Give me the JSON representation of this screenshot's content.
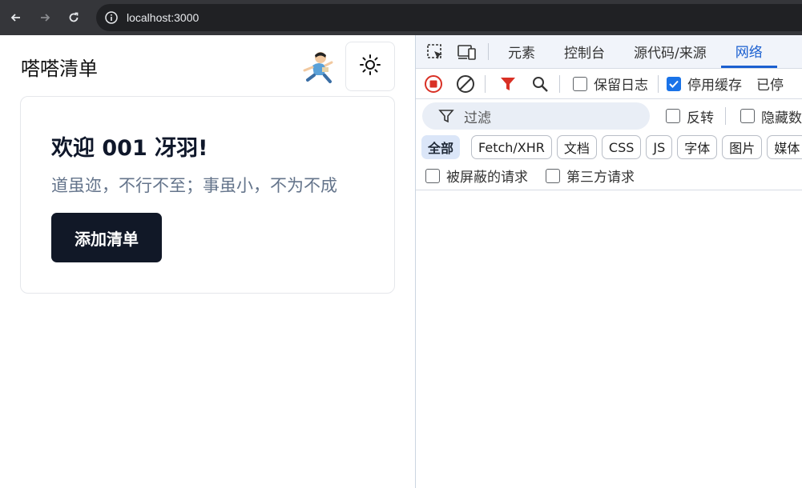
{
  "browser": {
    "url": "localhost:3000",
    "icons": [
      "back-arrow-icon",
      "forward-arrow-icon",
      "reload-icon",
      "site-info-icon"
    ]
  },
  "app": {
    "title": "嗒嗒清单",
    "welcome": "欢迎 001 冴羽!",
    "motto": "道虽迩，不行不至；事虽小，不为不成",
    "add_button": "添加清单",
    "colors": {
      "button_bg": "#111827",
      "muted_text": "#64748b",
      "border": "#e5e7eb"
    }
  },
  "devtools": {
    "tabs": [
      {
        "label": "元素",
        "active": false
      },
      {
        "label": "控制台",
        "active": false
      },
      {
        "label": "源代码/来源",
        "active": false
      },
      {
        "label": "网络",
        "active": true
      }
    ],
    "toolbar": {
      "preserve_log": {
        "label": "保留日志",
        "checked": false
      },
      "disable_cache": {
        "label": "停用缓存",
        "checked": true
      },
      "throttling_label": "已停"
    },
    "filter": {
      "placeholder": "过滤",
      "invert": {
        "label": "反转",
        "checked": false
      },
      "hide_data": {
        "label": "隐藏数",
        "checked": false
      }
    },
    "types": [
      "全部",
      "Fetch/XHR",
      "文档",
      "CSS",
      "JS",
      "字体",
      "图片",
      "媒体"
    ],
    "blocked": [
      {
        "label": "被屏蔽的请求",
        "checked": false
      },
      {
        "label": "第三方请求",
        "checked": false
      }
    ],
    "colors": {
      "accent": "#1a5fd0",
      "record_red": "#d93025",
      "filter_red": "#d93025"
    }
  }
}
